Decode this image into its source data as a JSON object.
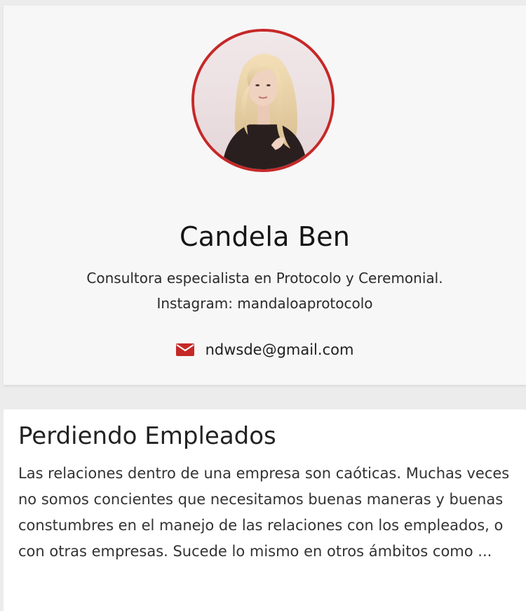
{
  "author": {
    "name": "Candela Ben",
    "bio": "Consultora especialista en Protocolo y Ceremonial. Instagram: mandaloaprotocolo",
    "email": "ndwsde@gmail.com",
    "avatar_icon": "author-photo",
    "email_icon": "envelope-icon"
  },
  "article": {
    "title": "Perdiendo Empleados",
    "excerpt": "Las relaciones dentro de una empresa son caóticas. Muchas veces no somos concientes que necesitamos buenas maneras y buenas constumbres en el manejo de las relaciones con los empleados, o con otras empresas. Sucede lo mismo en otros ámbitos como ..."
  },
  "colors": {
    "accent": "#c62828",
    "card_background": "#f7f7f7",
    "page_background": "#ececec"
  }
}
